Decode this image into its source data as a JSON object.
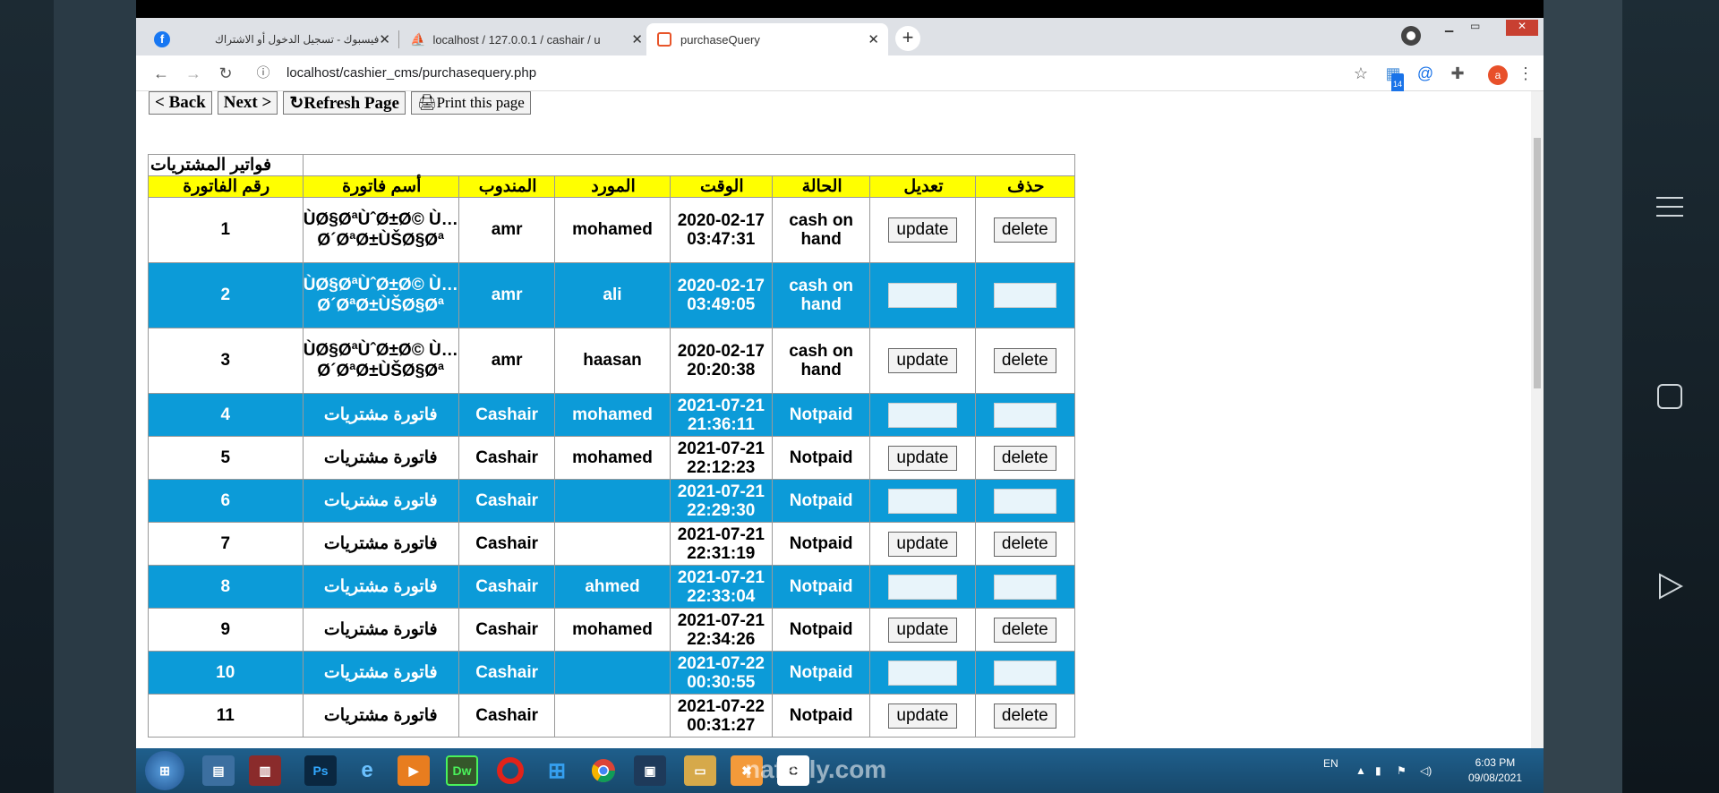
{
  "browser": {
    "tabs": [
      {
        "title": "فيسبوك - تسجيل الدخول أو الاشتراك",
        "icon": "facebook-icon"
      },
      {
        "title": "localhost / 127.0.0.1 / cashair / u",
        "icon": "phpmyadmin-icon"
      },
      {
        "title": "purchaseQuery",
        "icon": "page-icon"
      }
    ],
    "url": "localhost/cashier_cms/purchasequery.php",
    "profile_initial": "a",
    "extension_badge": "14"
  },
  "nav": {
    "back": "< Back",
    "next": "Next >",
    "refresh": "↻Refresh Page",
    "print": "🖨Print this page"
  },
  "table": {
    "title": "فواتير المشتريات",
    "headers": {
      "id": "رقم الفاتورة",
      "name": "أسم فاتورة",
      "rep": "المندوب",
      "supplier": "المورد",
      "time": "الوقت",
      "status": "الحالة",
      "edit": "تعديل",
      "delete": "حذف"
    },
    "update_label": "update",
    "delete_label": "delete",
    "rows": [
      {
        "id": "1",
        "name": "ÙØ§ØªÙˆØ±Ø© Ù…Ø´ØªØ±ÙŠØ§Øª",
        "rep": "amr",
        "supplier": "mohamed",
        "date": "2020-02-17",
        "time": "03:47:31",
        "status": "cash on hand"
      },
      {
        "id": "2",
        "name": "ÙØ§ØªÙˆØ±Ø© Ù…Ø´ØªØ±ÙŠØ§Øª",
        "rep": "amr",
        "supplier": "ali",
        "date": "2020-02-17",
        "time": "03:49:05",
        "status": "cash on hand"
      },
      {
        "id": "3",
        "name": "ÙØ§ØªÙˆØ±Ø© Ù…Ø´ØªØ±ÙŠØ§Øª",
        "rep": "amr",
        "supplier": "haasan",
        "date": "2020-02-17",
        "time": "20:20:38",
        "status": "cash on hand"
      },
      {
        "id": "4",
        "name": "فاتورة مشتريات",
        "rep": "Cashair",
        "supplier": "mohamed",
        "date": "2021-07-21",
        "time": "21:36:11",
        "status": "Notpaid"
      },
      {
        "id": "5",
        "name": "فاتورة مشتريات",
        "rep": "Cashair",
        "supplier": "mohamed",
        "date": "2021-07-21",
        "time": "22:12:23",
        "status": "Notpaid"
      },
      {
        "id": "6",
        "name": "فاتورة مشتريات",
        "rep": "Cashair",
        "supplier": "",
        "date": "2021-07-21",
        "time": "22:29:30",
        "status": "Notpaid"
      },
      {
        "id": "7",
        "name": "فاتورة مشتريات",
        "rep": "Cashair",
        "supplier": "",
        "date": "2021-07-21",
        "time": "22:31:19",
        "status": "Notpaid"
      },
      {
        "id": "8",
        "name": "فاتورة مشتريات",
        "rep": "Cashair",
        "supplier": "ahmed",
        "date": "2021-07-21",
        "time": "22:33:04",
        "status": "Notpaid"
      },
      {
        "id": "9",
        "name": "فاتورة مشتريات",
        "rep": "Cashair",
        "supplier": "mohamed",
        "date": "2021-07-21",
        "time": "22:34:26",
        "status": "Notpaid"
      },
      {
        "id": "10",
        "name": "فاتورة مشتريات",
        "rep": "Cashair",
        "supplier": "",
        "date": "2021-07-22",
        "time": "00:30:55",
        "status": "Notpaid"
      },
      {
        "id": "11",
        "name": "فاتورة مشتريات",
        "rep": "Cashair",
        "supplier": "",
        "date": "2021-07-22",
        "time": "00:31:27",
        "status": "Notpaid"
      }
    ]
  },
  "taskbar": {
    "lang": "EN",
    "time": "6:03 PM",
    "date": "09/08/2021",
    "apps": [
      "Ps",
      "Dw"
    ]
  },
  "watermark": "nafezly.com",
  "colors": {
    "header_bg": "#ffff00",
    "header_text": "#1b3ea8",
    "alt_row": "#0c9bd8"
  }
}
